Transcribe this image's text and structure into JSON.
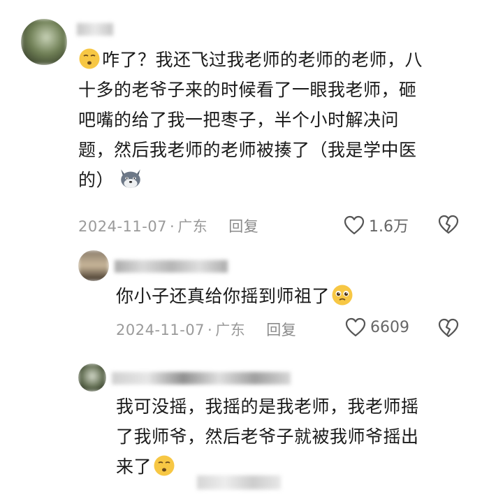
{
  "comments": [
    {
      "text_lines": [
        "咋了？我还飞过我老师的老师的老师，八",
        "十多的老爷子来的时候看了一眼我老师，砸",
        "吧嘴的给了我一把枣子，半个小时解决问",
        "题，然后我老师的老师被揍了（我是学中医",
        "的）"
      ],
      "date": "2024-11-07",
      "location": "广东",
      "reply_label": "回复",
      "like_count": "1.6万",
      "lead_emoji": "thinking-face",
      "trail_emoji": "doge-wolf"
    },
    {
      "text_lines": [
        "你小子还真给你摇到师祖了"
      ],
      "date": "2024-11-07",
      "location": "广东",
      "reply_label": "回复",
      "like_count": "6609",
      "trail_emoji": "pleading-face"
    },
    {
      "text_lines": [
        "我可没摇，我摇的是我老师，我老师摇",
        "了我师爷，然后老爷子就被我师爷摇出",
        "来了"
      ],
      "trail_emoji": "thinking-face"
    }
  ],
  "meta_separator": "·",
  "colors": {
    "text": "#1a1a1a",
    "meta": "#9a9a9a",
    "emoji_yellow": "#F7C744"
  }
}
